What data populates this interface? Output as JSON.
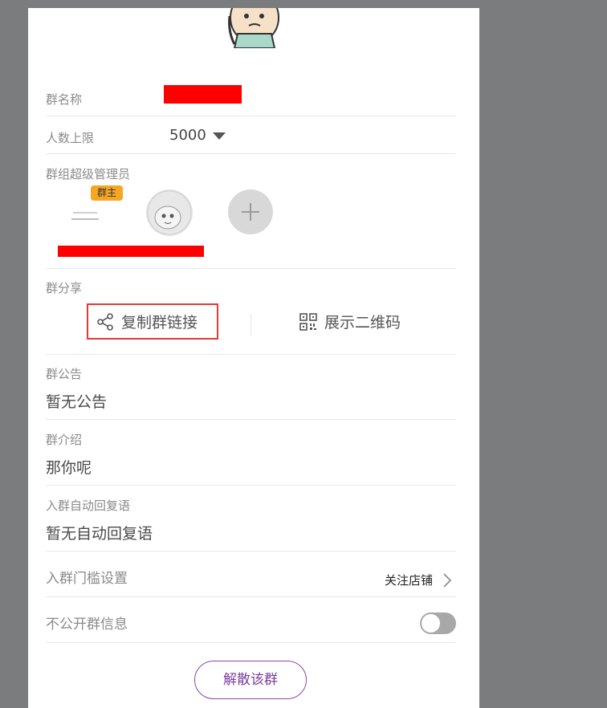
{
  "group": {
    "name_label": "群名称",
    "limit_label": "人数上限",
    "limit_value": "5000",
    "admins_label": "群组超级管理员",
    "owner_badge": "群主",
    "share_label": "群分享",
    "copy_link_label": "复制群链接",
    "show_qr_label": "展示二维码",
    "announcement_label": "群公告",
    "announcement_value": "暂无公告",
    "intro_label": "群介绍",
    "intro_value": "那你呢",
    "auto_reply_label": "入群自动回复语",
    "auto_reply_value": "暂无自动回复语",
    "threshold_label": "入群门槛设置",
    "threshold_value": "关注店铺",
    "private_label": "不公开群信息",
    "private_enabled": false,
    "dissolve_label": "解散该群"
  },
  "icons": [
    "share-icon",
    "qr-code-icon",
    "chevron-right-icon",
    "plus-icon",
    "caret-down-icon"
  ],
  "colors": {
    "highlight": "#e53935",
    "dissolve": "#7b3fa0",
    "badge": "#f5a623"
  }
}
